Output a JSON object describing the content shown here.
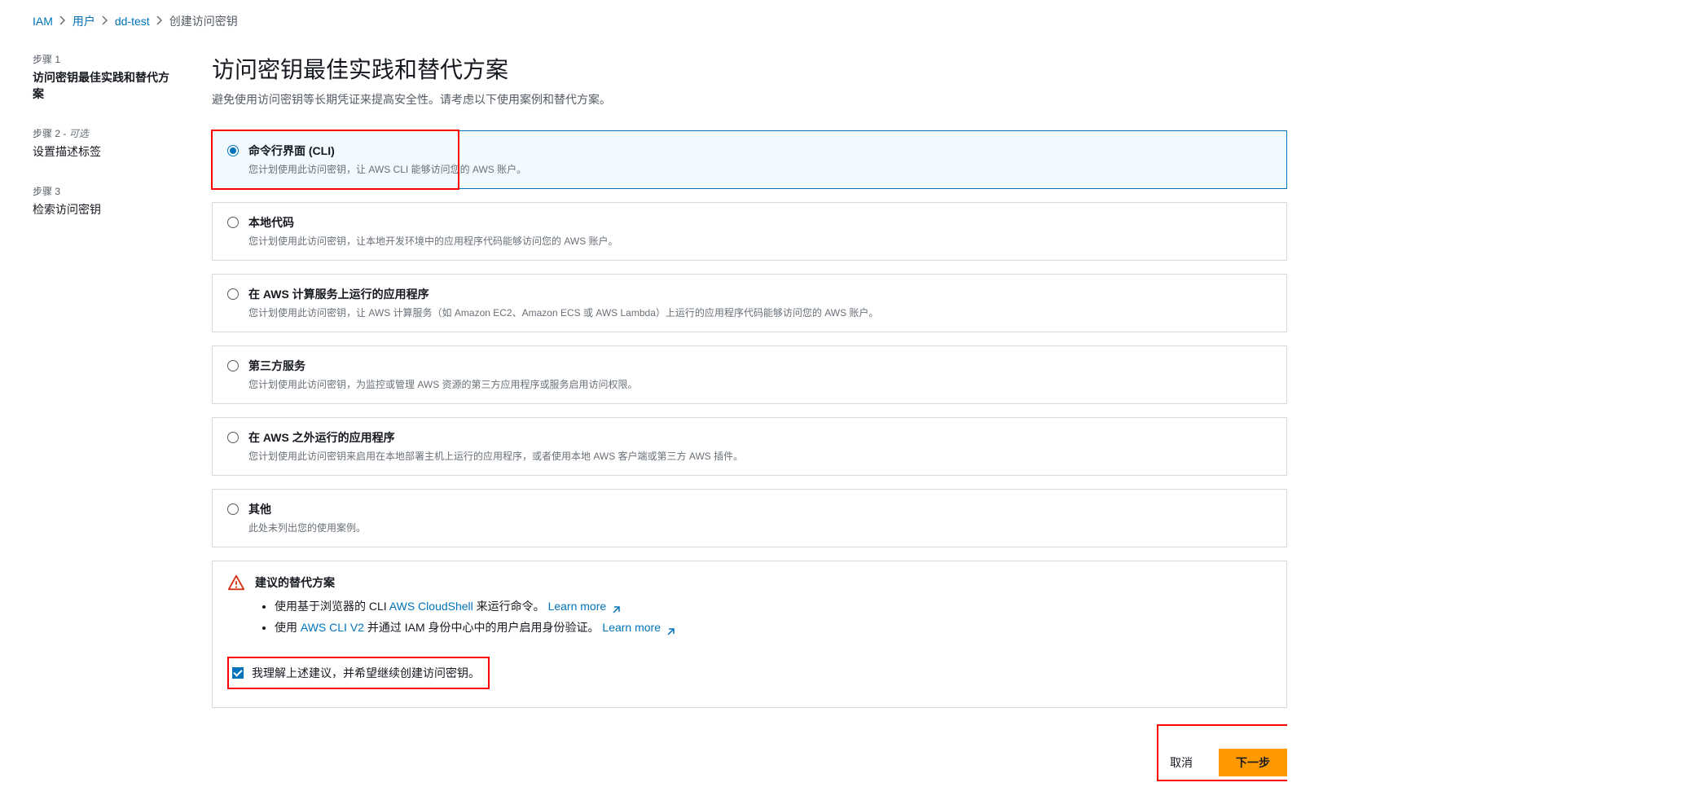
{
  "breadcrumb": {
    "items": [
      "IAM",
      "用户",
      "dd-test"
    ],
    "current": "创建访问密钥"
  },
  "sidebar": {
    "steps": [
      {
        "label": "步骤 1",
        "title": "访问密钥最佳实践和替代方案",
        "optional": ""
      },
      {
        "label": "步骤 2 - ",
        "title": "设置描述标签",
        "optional": "可选"
      },
      {
        "label": "步骤 3",
        "title": "检索访问密钥",
        "optional": ""
      }
    ]
  },
  "header": {
    "title": "访问密钥最佳实践和替代方案",
    "subtitle": "避免使用访问密钥等长期凭证来提高安全性。请考虑以下使用案例和替代方案。"
  },
  "options": [
    {
      "title": "命令行界面 (CLI)",
      "desc": "您计划使用此访问密钥，让 AWS CLI 能够访问您的 AWS 账户。"
    },
    {
      "title": "本地代码",
      "desc": "您计划使用此访问密钥，让本地开发环境中的应用程序代码能够访问您的 AWS 账户。"
    },
    {
      "title": "在 AWS 计算服务上运行的应用程序",
      "desc": "您计划使用此访问密钥，让 AWS 计算服务（如 Amazon EC2、Amazon ECS 或 AWS Lambda）上运行的应用程序代码能够访问您的 AWS 账户。"
    },
    {
      "title": "第三方服务",
      "desc": "您计划使用此访问密钥，为监控或管理 AWS 资源的第三方应用程序或服务启用访问权限。"
    },
    {
      "title": "在 AWS 之外运行的应用程序",
      "desc": "您计划使用此访问密钥来启用在本地部署主机上运行的应用程序，或者使用本地 AWS 客户端或第三方 AWS 插件。"
    },
    {
      "title": "其他",
      "desc": "此处未列出您的使用案例。"
    }
  ],
  "alternatives": {
    "title": "建议的替代方案",
    "item1_prefix": "使用基于浏览器的 CLI ",
    "item1_link": "AWS CloudShell",
    "item1_suffix": " 来运行命令。 ",
    "item2_prefix": "使用 ",
    "item2_link": "AWS CLI V2",
    "item2_suffix": " 并通过 IAM 身份中心中的用户启用身份验证。 ",
    "learn_more": "Learn more"
  },
  "confirm": {
    "label": "我理解上述建议，并希望继续创建访问密钥。"
  },
  "footer": {
    "cancel": "取消",
    "next": "下一步"
  }
}
